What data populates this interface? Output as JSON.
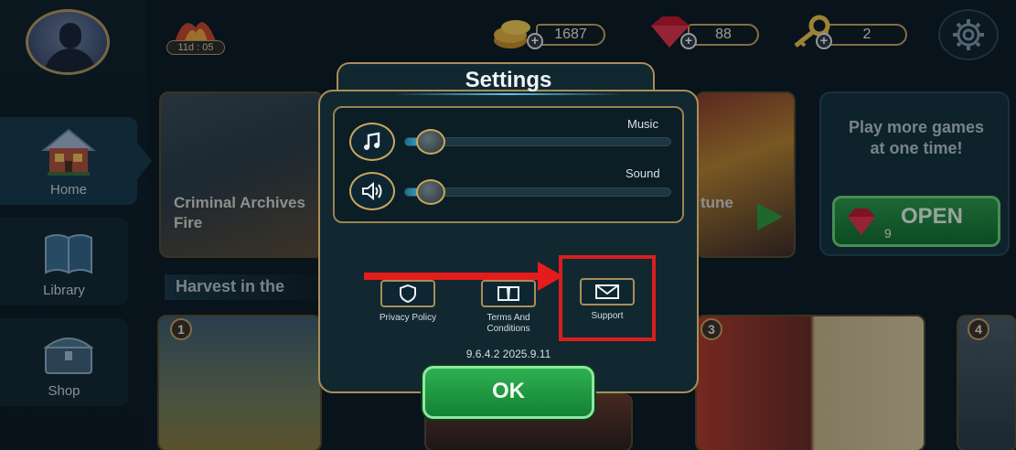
{
  "colors": {
    "accent_gold": "#c8a75c",
    "panel": "#112831",
    "ok_green": "#1e9a41",
    "annotation_red": "#e51c1c"
  },
  "sidebar": {
    "items": [
      {
        "label": "Home",
        "icon": "house-icon",
        "active": true
      },
      {
        "label": "Library",
        "icon": "book-icon",
        "active": false
      },
      {
        "label": "Shop",
        "icon": "chest-icon",
        "active": false
      }
    ]
  },
  "topbar": {
    "event_timer": "11d : 05",
    "coins": "1687",
    "gems": "88",
    "keys": "2"
  },
  "cards": {
    "featured_left_title": "Criminal Archives",
    "featured_left_subtitle": "Fire",
    "featured_right_fragment": "tune",
    "section_title": "Harvest in the",
    "numbers": [
      "1",
      "3",
      "4"
    ]
  },
  "promo": {
    "text": "Play more games at one time!",
    "open_label": "OPEN",
    "open_count": "9"
  },
  "settings": {
    "title": "Settings",
    "music_label": "Music",
    "music_level": 0.1,
    "sound_label": "Sound",
    "sound_level": 0.1,
    "links": [
      {
        "label": "Privacy Policy",
        "icon": "shield-icon"
      },
      {
        "label": "Terms And Conditions",
        "icon": "book-open-icon"
      },
      {
        "label": "Support",
        "icon": "mail-icon"
      }
    ],
    "version": "9.6.4.2 2025.9.11",
    "ok_label": "OK"
  }
}
